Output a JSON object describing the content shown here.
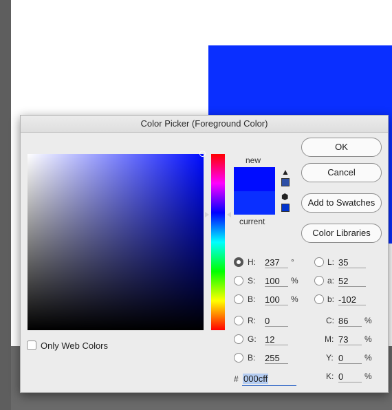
{
  "dialog": {
    "title": "Color Picker (Foreground Color)"
  },
  "colors": {
    "selected": "#000cff",
    "current": "#0a2fff",
    "hue_pure": "#000cff",
    "canvas_shape": "#0a2fff",
    "web_safe_nearest": "#0033cc",
    "gamut_warning": "#2d4fa6"
  },
  "preview": {
    "new_label": "new",
    "current_label": "current"
  },
  "icons": {
    "out_of_gamut": "warning-triangle-icon",
    "not_web_safe": "cube-icon"
  },
  "buttons": {
    "ok": "OK",
    "cancel": "Cancel",
    "add_to_swatches": "Add to Swatches",
    "color_libraries": "Color Libraries"
  },
  "hsb": {
    "h": {
      "label": "H:",
      "value": "237",
      "unit": "°"
    },
    "s": {
      "label": "S:",
      "value": "100",
      "unit": "%"
    },
    "b": {
      "label": "B:",
      "value": "100",
      "unit": "%"
    }
  },
  "rgb": {
    "r": {
      "label": "R:",
      "value": "0"
    },
    "g": {
      "label": "G:",
      "value": "12"
    },
    "b": {
      "label": "B:",
      "value": "255"
    }
  },
  "lab": {
    "l": {
      "label": "L:",
      "value": "35"
    },
    "a": {
      "label": "a:",
      "value": "52"
    },
    "b": {
      "label": "b:",
      "value": "-102"
    }
  },
  "cmyk": {
    "c": {
      "label": "C:",
      "value": "86",
      "unit": "%"
    },
    "m": {
      "label": "M:",
      "value": "73",
      "unit": "%"
    },
    "y": {
      "label": "Y:",
      "value": "0",
      "unit": "%"
    },
    "k": {
      "label": "K:",
      "value": "0",
      "unit": "%"
    }
  },
  "hex": {
    "prefix": "#",
    "value": "000cff"
  },
  "options": {
    "only_web_colors": "Only Web Colors"
  }
}
